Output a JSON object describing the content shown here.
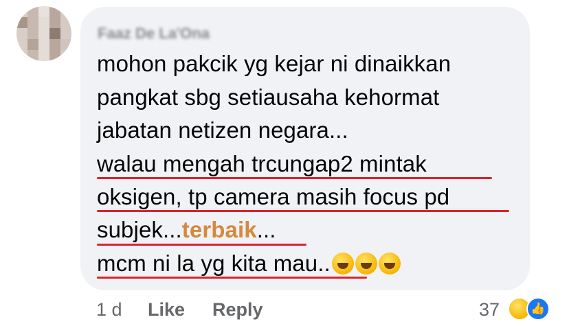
{
  "author": {
    "name": "Faaz De La'Ona"
  },
  "comment": {
    "lines": [
      "mohon pakcik yg kejar ni dinaikkan",
      "pangkat sbg setiausaha kehormat",
      "jabatan netizen negara...",
      "walau mengah trcungap2 mintak",
      "oksigen, tp camera masih focus pd"
    ],
    "line6_prefix": "subjek...",
    "line6_highlight": "terbaik",
    "line6_suffix": "...",
    "line7": "mcm ni la yg kita mau.."
  },
  "footer": {
    "time": "1 d",
    "like_label": "Like",
    "reply_label": "Reply",
    "reaction_count": "37",
    "reactions": [
      "haha-emoji-icon",
      "like-thumb-icon"
    ]
  },
  "colors": {
    "bubble": "#f0f2f5",
    "highlight": "#d5893e",
    "underline": "#e0202a",
    "meta": "#65676b"
  }
}
